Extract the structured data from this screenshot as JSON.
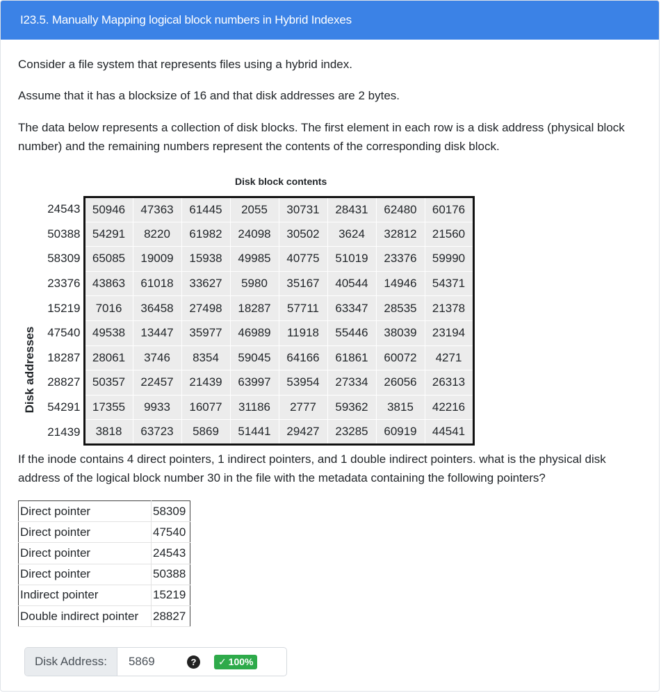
{
  "header": {
    "title": "I23.5. Manually Mapping logical block numbers in Hybrid Indexes"
  },
  "intro": {
    "p1": "Consider a file system that represents files using a hybrid index.",
    "p2": "Assume that it has a blocksize of 16 and that disk addresses are 2 bytes.",
    "p3": "The data below represents a collection of disk blocks. The first element in each row is a disk address (physical block number) and the remaining numbers represent the contents of the corresponding disk block."
  },
  "figure": {
    "title": "Disk block contents",
    "y_label": "Disk addresses",
    "rows": [
      {
        "addr": "24543",
        "values": [
          "50946",
          "47363",
          "61445",
          "2055",
          "30731",
          "28431",
          "62480",
          "60176"
        ]
      },
      {
        "addr": "50388",
        "values": [
          "54291",
          "8220",
          "61982",
          "24098",
          "30502",
          "3624",
          "32812",
          "21560"
        ]
      },
      {
        "addr": "58309",
        "values": [
          "65085",
          "19009",
          "15938",
          "49985",
          "40775",
          "51019",
          "23376",
          "59990"
        ]
      },
      {
        "addr": "23376",
        "values": [
          "43863",
          "61018",
          "33627",
          "5980",
          "35167",
          "40544",
          "14946",
          "54371"
        ]
      },
      {
        "addr": "15219",
        "values": [
          "7016",
          "36458",
          "27498",
          "18287",
          "57711",
          "63347",
          "28535",
          "21378"
        ]
      },
      {
        "addr": "47540",
        "values": [
          "49538",
          "13447",
          "35977",
          "46989",
          "11918",
          "55446",
          "38039",
          "23194"
        ]
      },
      {
        "addr": "18287",
        "values": [
          "28061",
          "3746",
          "8354",
          "59045",
          "64166",
          "61861",
          "60072",
          "4271"
        ]
      },
      {
        "addr": "28827",
        "values": [
          "50357",
          "22457",
          "21439",
          "63997",
          "53954",
          "27334",
          "26056",
          "26313"
        ]
      },
      {
        "addr": "54291",
        "values": [
          "17355",
          "9933",
          "16077",
          "31186",
          "2777",
          "59362",
          "3815",
          "42216"
        ]
      },
      {
        "addr": "21439",
        "values": [
          "3818",
          "63723",
          "5869",
          "51441",
          "29427",
          "23285",
          "60919",
          "44541"
        ]
      }
    ]
  },
  "question": "If the inode contains 4 direct pointers, 1 indirect pointers, and 1 double indirect pointers. what is the physical disk address of the logical block number 30 in the file with the metadata containing the following pointers?",
  "pointers": [
    {
      "label": "Direct pointer",
      "value": "58309"
    },
    {
      "label": "Direct pointer",
      "value": "47540"
    },
    {
      "label": "Direct pointer",
      "value": "24543"
    },
    {
      "label": "Direct pointer",
      "value": "50388"
    },
    {
      "label": "Indirect pointer",
      "value": "15219"
    },
    {
      "label": "Double indirect pointer",
      "value": "28827"
    }
  ],
  "answer": {
    "label": "Disk Address:",
    "value": "5869",
    "help_icon": "question-circle-icon",
    "score": "100%",
    "score_icon": "check-icon",
    "score_color": "#2eaa4a"
  }
}
